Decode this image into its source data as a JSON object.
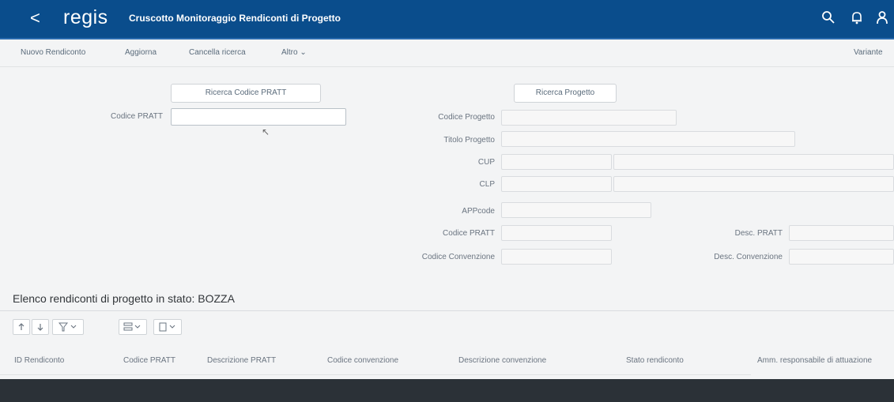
{
  "shell": {
    "back_glyph": "<",
    "logo": "regis",
    "title": "Cruscotto Monitoraggio Rendiconti di Progetto",
    "color": "#0a4d8c",
    "icons": [
      "search-icon",
      "bell-icon",
      "user-icon"
    ]
  },
  "toolbar": {
    "items": [
      "Nuovo Rendiconto",
      "Aggiorna",
      "Cancella ricerca",
      "Altro"
    ],
    "right_item": "Variante"
  },
  "pratt_search": {
    "button": "Ricerca Codice PRATT",
    "label": "Codice PRATT",
    "value": ""
  },
  "progetto_search": {
    "button": "Ricerca Progetto",
    "fields": {
      "codice_progetto": "Codice Progetto",
      "titolo_progetto": "Titolo Progetto",
      "cup": "CUP",
      "clp": "CLP",
      "appcode": "APPcode",
      "codice_pratt": "Codice PRATT",
      "codice_convenzione": "Codice Convenzione",
      "desc_pratt": "Desc. PRATT",
      "desc_convenzione": "Desc. Convenzione"
    }
  },
  "list": {
    "title": "Elenco rendiconti di progetto in stato: BOZZA",
    "accent": "#0a6ed1",
    "columns": [
      "ID Rendiconto",
      "Codice PRATT",
      "Descrizione PRATT",
      "Codice convenzione",
      "Descrizione convenzione",
      "Stato rendiconto",
      "Amm. responsabile di attuazione"
    ]
  }
}
